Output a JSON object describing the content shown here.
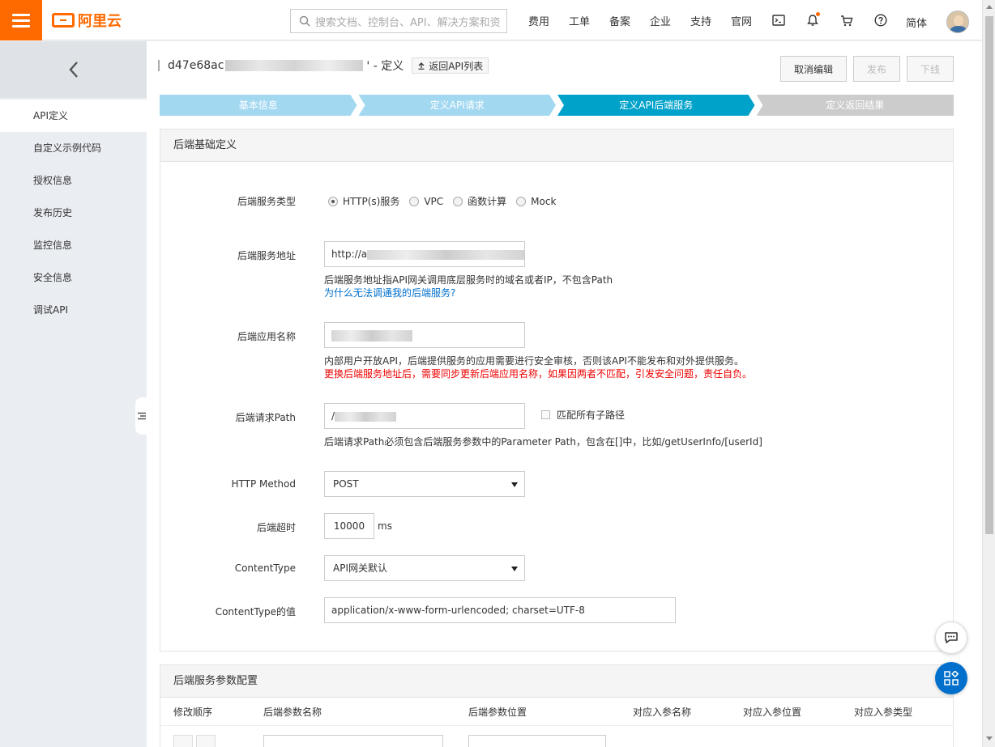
{
  "colors": {
    "brand": "#ff6a00",
    "accent": "#00a2ca",
    "link": "#0070cc",
    "warn": "#e00000"
  },
  "topbar": {
    "logo_text": "阿里云",
    "search_placeholder": "搜索文档、控制台、API、解决方案和资",
    "nav": [
      "费用",
      "工单",
      "备案",
      "企业",
      "支持",
      "官网"
    ],
    "icons": [
      "terminal-icon",
      "bell-icon",
      "cart-icon",
      "help-icon"
    ],
    "lang": "简体"
  },
  "sidebar": {
    "items": [
      "API定义",
      "自定义示例代码",
      "授权信息",
      "发布历史",
      "监控信息",
      "安全信息",
      "调试API"
    ],
    "active_index": 0
  },
  "header": {
    "api_id_prefix": "d47e68ac",
    "api_id_suffix": "' - 定义",
    "back_label": "返回API列表",
    "buttons": {
      "cancel": "取消编辑",
      "publish": "发布",
      "offline": "下线"
    }
  },
  "steps": [
    {
      "label": "基本信息",
      "state": "done"
    },
    {
      "label": "定义API请求",
      "state": "done"
    },
    {
      "label": "定义API后端服务",
      "state": "current"
    },
    {
      "label": "定义返回结果",
      "state": "todo"
    }
  ],
  "backend": {
    "title": "后端基础定义",
    "service_type": {
      "label": "后端服务类型",
      "options": [
        "HTTP(s)服务",
        "VPC",
        "函数计算",
        "Mock"
      ],
      "selected_index": 0
    },
    "address": {
      "label": "后端服务地址",
      "value_prefix": "http://a",
      "value_suffix": "8",
      "help": "后端服务地址指API网关调用底层服务时的域名或者IP，不包含Path",
      "link": "为什么无法调通我的后端服务?"
    },
    "app_name": {
      "label": "后端应用名称",
      "help": "内部用户开放API，后端提供服务的应用需要进行安全审核，否则该API不能发布和对外提供服务。",
      "warn": "更换后端服务地址后，需要同步更新后端应用名称，如果因两者不匹配，引发安全问题，责任自负。"
    },
    "path": {
      "label": "后端请求Path",
      "value_prefix": "/",
      "checkbox_label": "匹配所有子路径",
      "help": "后端请求Path必须包含后端服务参数中的Parameter Path，包含在[]中，比如/getUserInfo/[userId]"
    },
    "method": {
      "label": "HTTP Method",
      "value": "POST"
    },
    "timeout": {
      "label": "后端超时",
      "value": "10000",
      "unit": "ms"
    },
    "content_type": {
      "label": "ContentType",
      "value": "API网关默认"
    },
    "content_type_value": {
      "label": "ContentType的值",
      "value": "application/x-www-form-urlencoded; charset=UTF-8"
    }
  },
  "params": {
    "title": "后端服务参数配置",
    "columns": [
      "修改顺序",
      "后端参数名称",
      "后端参数位置",
      "对应入参名称",
      "对应入参位置",
      "对应入参类型"
    ]
  }
}
